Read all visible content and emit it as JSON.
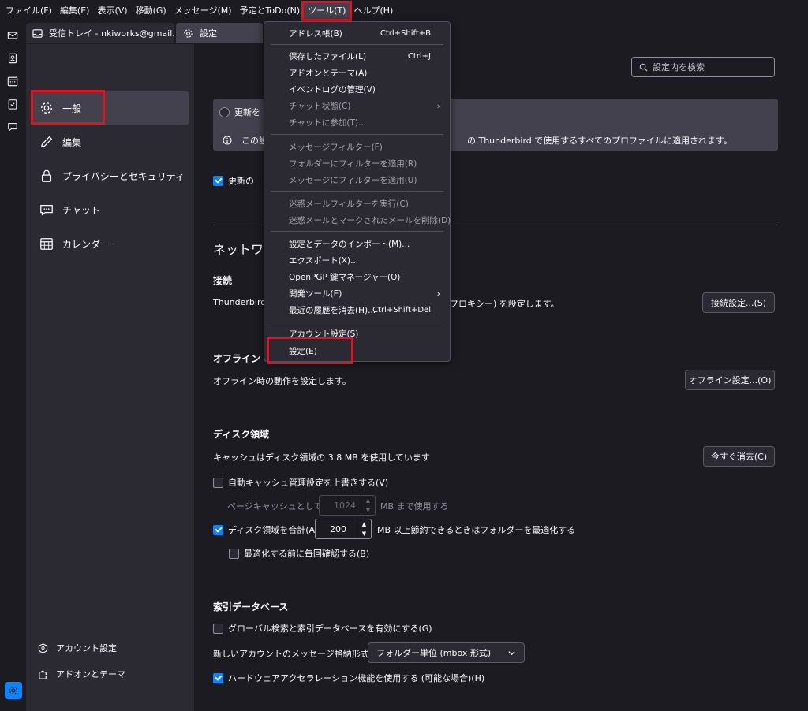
{
  "menubar": {
    "items": [
      {
        "label": "ファイル(F)"
      },
      {
        "label": "編集(E)"
      },
      {
        "label": "表示(V)"
      },
      {
        "label": "移動(G)"
      },
      {
        "label": "メッセージ(M)"
      },
      {
        "label": "予定とToDo(N)"
      },
      {
        "label": "ツール(T)"
      },
      {
        "label": "ヘルプ(H)"
      }
    ]
  },
  "tabs": [
    {
      "label": "受信トレイ - nkiworks@gmail.com",
      "icon": "inbox-icon"
    },
    {
      "label": "設定",
      "icon": "gear-icon"
    }
  ],
  "categories": [
    {
      "label": "一般",
      "icon": "gear-icon"
    },
    {
      "label": "編集",
      "icon": "pencil-icon"
    },
    {
      "label": "プライバシーとセキュリティ",
      "icon": "lock-icon"
    },
    {
      "label": "チャット",
      "icon": "chat-icon"
    },
    {
      "label": "カレンダー",
      "icon": "calendar-icon"
    }
  ],
  "sidebar_footer": {
    "account_settings": "アカウント設定",
    "addons": "アドオンとテーマ"
  },
  "search": {
    "placeholder": "設定内を検索"
  },
  "update": {
    "radio_label": "更新を",
    "info_prefix": "この設",
    "info_suffix": "の Thunderbird で使用するすべてのプロファイルに適用されます。",
    "checkbox_label": "更新の"
  },
  "network": {
    "heading": "ネットワー",
    "connection_heading": "接続",
    "connection_text": "Thunderbird",
    "connection_tail": "プロキシー) を設定します。",
    "connection_button": "接続設定...(S)",
    "offline_heading": "オフライン",
    "offline_text": "オフライン時の動作を設定します。",
    "offline_button": "オフライン設定...(O)"
  },
  "disk": {
    "heading": "ディスク領域",
    "cache_text": "キャッシュはディスク領域の 3.8 MB を使用しています",
    "clear_button": "今すぐ消去(C)",
    "override_cache_label": "自動キャッシュ管理設定を上書きする(V)",
    "page_cache_label": "ページキャッシュとして(U)",
    "page_cache_value": "1024",
    "page_cache_unit": "MB まで使用する",
    "compact_label": "ディスク領域を合計(A)",
    "compact_value": "200",
    "compact_unit": "MB 以上節約できるときはフォルダーを最適化する",
    "ask_label": "最適化する前に毎回確認する(B)"
  },
  "index": {
    "heading": "索引データベース",
    "global_search_label": "グローバル検索と索引データベースを有効にする(G)",
    "store_type_label": "新しいアカウントのメッセージ格納形式(T):",
    "store_type_value": "フォルダー単位 (mbox 形式)",
    "hw_accel_label": "ハードウェアアクセラレーション機能を使用する (可能な場合)(H)"
  },
  "tools_menu": {
    "address_book": "アドレス帳(B)",
    "address_book_sc": "Ctrl+Shift+B",
    "saved_files": "保存したファイル(L)",
    "saved_files_sc": "Ctrl+J",
    "addons": "アドオンとテーマ(A)",
    "event_log": "イベントログの管理(V)",
    "chat_status": "チャット状態(C)",
    "join_chat": "チャットに参加(T)...",
    "message_filters": "メッセージフィルター(F)",
    "run_filters_folder": "フォルダーにフィルターを適用(R)",
    "run_filters_message": "メッセージにフィルターを適用(U)",
    "junk_filters": "迷惑メールフィルターを実行(C)",
    "delete_junk": "迷惑メールとマークされたメールを削除(D)",
    "import": "設定とデータのインポート(M)...",
    "export": "エクスポート(X)...",
    "openpgp": "OpenPGP 鍵マネージャー(O)",
    "dev_tools": "開発ツール(E)",
    "clear_history": "最近の履歴を消去(H)...",
    "clear_history_sc": "Ctrl+Shift+Del",
    "account_settings": "アカウント設定(S)",
    "settings": "設定(E)"
  },
  "colors": {
    "accent": "#0a84ff",
    "highlight": "#e0141e",
    "background": "#1c1b22"
  }
}
